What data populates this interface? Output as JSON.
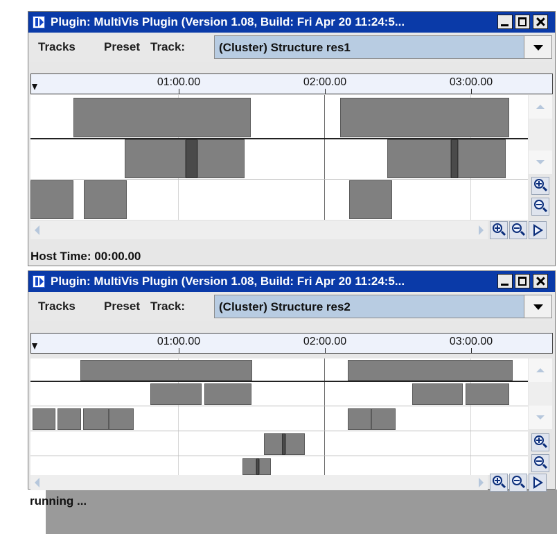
{
  "windows": [
    {
      "title": "Plugin: MultiVis Plugin (Version 1.08, Build: Fri Apr 20 11:24:5...",
      "menu": {
        "tracks": "Tracks",
        "preset": "Preset",
        "track": "Track:"
      },
      "combo_value": "(Cluster) Structure res1",
      "ruler_ticks": [
        "01:00.00",
        "02:00.00",
        "03:00.00"
      ],
      "status": "Host Time: 00:00.00"
    },
    {
      "title": "Plugin: MultiVis Plugin (Version 1.08, Build: Fri Apr 20 11:24:5...",
      "menu": {
        "tracks": "Tracks",
        "preset": "Preset",
        "track": "Track:"
      },
      "combo_value": "(Cluster) Structure res2",
      "ruler_ticks": [
        "01:00.00",
        "02:00.00",
        "03:00.00"
      ],
      "status": "running ..."
    }
  ],
  "icons": {
    "window_controls": [
      "minimize-icon",
      "maximize-icon",
      "close-icon"
    ],
    "zoom": [
      "zoom-in-icon",
      "zoom-out-icon"
    ],
    "play": "play-icon"
  },
  "colors": {
    "titlebar": "#0a3aa8",
    "combo": "#b8cce2",
    "segment": "#808080",
    "segment_dark": "#4a4a4a"
  }
}
